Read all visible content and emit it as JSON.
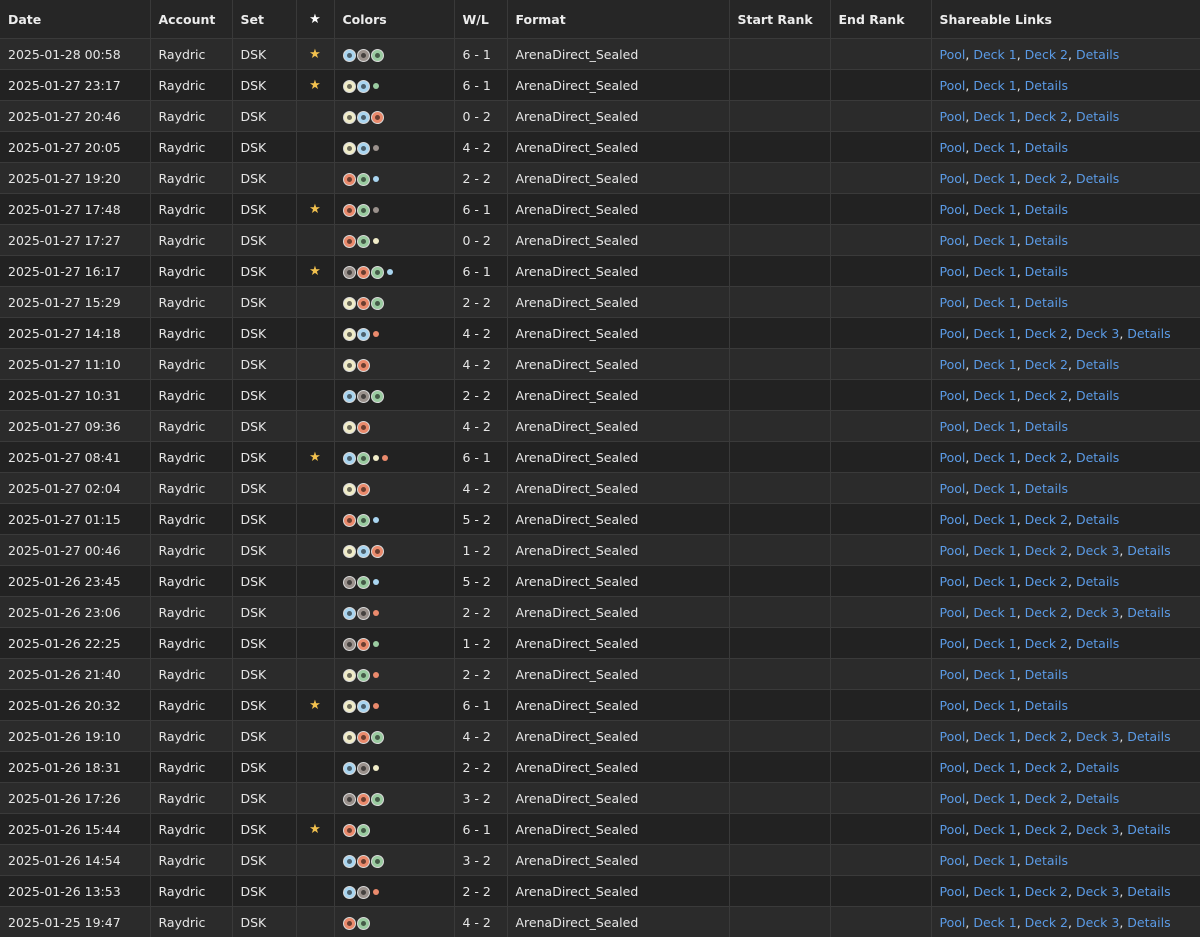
{
  "headers": {
    "date": "Date",
    "account": "Account",
    "set": "Set",
    "star": "★",
    "colors": "Colors",
    "wl": "W/L",
    "format": "Format",
    "start_rank": "Start Rank",
    "end_rank": "End Rank",
    "links": "Shareable Links"
  },
  "color_map": {
    "W": "#f0ecc8",
    "U": "#a9d5f0",
    "B": "#9a918c",
    "R": "#ea8a6c",
    "G": "#9acba0"
  },
  "rows": [
    {
      "date": "2025-01-28 00:58",
      "account": "Raydric",
      "set": "DSK",
      "starred": true,
      "symbols": [
        "U",
        "B",
        "G"
      ],
      "dots": [],
      "wl": "6 - 1",
      "format": "ArenaDirect_Sealed",
      "start_rank": "",
      "end_rank": "",
      "links": [
        "Pool",
        "Deck 1",
        "Deck 2",
        "Details"
      ]
    },
    {
      "date": "2025-01-27 23:17",
      "account": "Raydric",
      "set": "DSK",
      "starred": true,
      "symbols": [
        "W",
        "U"
      ],
      "dots": [
        "G"
      ],
      "wl": "6 - 1",
      "format": "ArenaDirect_Sealed",
      "start_rank": "",
      "end_rank": "",
      "links": [
        "Pool",
        "Deck 1",
        "Details"
      ]
    },
    {
      "date": "2025-01-27 20:46",
      "account": "Raydric",
      "set": "DSK",
      "starred": false,
      "symbols": [
        "W",
        "U",
        "R"
      ],
      "dots": [],
      "wl": "0 - 2",
      "format": "ArenaDirect_Sealed",
      "start_rank": "",
      "end_rank": "",
      "links": [
        "Pool",
        "Deck 1",
        "Deck 2",
        "Details"
      ]
    },
    {
      "date": "2025-01-27 20:05",
      "account": "Raydric",
      "set": "DSK",
      "starred": false,
      "symbols": [
        "W",
        "U"
      ],
      "dots": [
        "B"
      ],
      "wl": "4 - 2",
      "format": "ArenaDirect_Sealed",
      "start_rank": "",
      "end_rank": "",
      "links": [
        "Pool",
        "Deck 1",
        "Details"
      ]
    },
    {
      "date": "2025-01-27 19:20",
      "account": "Raydric",
      "set": "DSK",
      "starred": false,
      "symbols": [
        "R",
        "G"
      ],
      "dots": [
        "U"
      ],
      "wl": "2 - 2",
      "format": "ArenaDirect_Sealed",
      "start_rank": "",
      "end_rank": "",
      "links": [
        "Pool",
        "Deck 1",
        "Deck 2",
        "Details"
      ]
    },
    {
      "date": "2025-01-27 17:48",
      "account": "Raydric",
      "set": "DSK",
      "starred": true,
      "symbols": [
        "R",
        "G"
      ],
      "dots": [
        "B"
      ],
      "wl": "6 - 1",
      "format": "ArenaDirect_Sealed",
      "start_rank": "",
      "end_rank": "",
      "links": [
        "Pool",
        "Deck 1",
        "Details"
      ]
    },
    {
      "date": "2025-01-27 17:27",
      "account": "Raydric",
      "set": "DSK",
      "starred": false,
      "symbols": [
        "R",
        "G"
      ],
      "dots": [
        "W"
      ],
      "wl": "0 - 2",
      "format": "ArenaDirect_Sealed",
      "start_rank": "",
      "end_rank": "",
      "links": [
        "Pool",
        "Deck 1",
        "Details"
      ]
    },
    {
      "date": "2025-01-27 16:17",
      "account": "Raydric",
      "set": "DSK",
      "starred": true,
      "symbols": [
        "B",
        "R",
        "G"
      ],
      "dots": [
        "U"
      ],
      "wl": "6 - 1",
      "format": "ArenaDirect_Sealed",
      "start_rank": "",
      "end_rank": "",
      "links": [
        "Pool",
        "Deck 1",
        "Details"
      ]
    },
    {
      "date": "2025-01-27 15:29",
      "account": "Raydric",
      "set": "DSK",
      "starred": false,
      "symbols": [
        "W",
        "R",
        "G"
      ],
      "dots": [],
      "wl": "2 - 2",
      "format": "ArenaDirect_Sealed",
      "start_rank": "",
      "end_rank": "",
      "links": [
        "Pool",
        "Deck 1",
        "Details"
      ]
    },
    {
      "date": "2025-01-27 14:18",
      "account": "Raydric",
      "set": "DSK",
      "starred": false,
      "symbols": [
        "W",
        "U"
      ],
      "dots": [
        "R"
      ],
      "wl": "4 - 2",
      "format": "ArenaDirect_Sealed",
      "start_rank": "",
      "end_rank": "",
      "links": [
        "Pool",
        "Deck 1",
        "Deck 2",
        "Deck 3",
        "Details"
      ]
    },
    {
      "date": "2025-01-27 11:10",
      "account": "Raydric",
      "set": "DSK",
      "starred": false,
      "symbols": [
        "W",
        "R"
      ],
      "dots": [],
      "wl": "4 - 2",
      "format": "ArenaDirect_Sealed",
      "start_rank": "",
      "end_rank": "",
      "links": [
        "Pool",
        "Deck 1",
        "Deck 2",
        "Details"
      ]
    },
    {
      "date": "2025-01-27 10:31",
      "account": "Raydric",
      "set": "DSK",
      "starred": false,
      "symbols": [
        "U",
        "B",
        "G"
      ],
      "dots": [],
      "wl": "2 - 2",
      "format": "ArenaDirect_Sealed",
      "start_rank": "",
      "end_rank": "",
      "links": [
        "Pool",
        "Deck 1",
        "Deck 2",
        "Details"
      ]
    },
    {
      "date": "2025-01-27 09:36",
      "account": "Raydric",
      "set": "DSK",
      "starred": false,
      "symbols": [
        "W",
        "R"
      ],
      "dots": [],
      "wl": "4 - 2",
      "format": "ArenaDirect_Sealed",
      "start_rank": "",
      "end_rank": "",
      "links": [
        "Pool",
        "Deck 1",
        "Details"
      ]
    },
    {
      "date": "2025-01-27 08:41",
      "account": "Raydric",
      "set": "DSK",
      "starred": true,
      "symbols": [
        "U",
        "G"
      ],
      "dots": [
        "W",
        "R"
      ],
      "wl": "6 - 1",
      "format": "ArenaDirect_Sealed",
      "start_rank": "",
      "end_rank": "",
      "links": [
        "Pool",
        "Deck 1",
        "Deck 2",
        "Details"
      ]
    },
    {
      "date": "2025-01-27 02:04",
      "account": "Raydric",
      "set": "DSK",
      "starred": false,
      "symbols": [
        "W",
        "R"
      ],
      "dots": [],
      "wl": "4 - 2",
      "format": "ArenaDirect_Sealed",
      "start_rank": "",
      "end_rank": "",
      "links": [
        "Pool",
        "Deck 1",
        "Details"
      ]
    },
    {
      "date": "2025-01-27 01:15",
      "account": "Raydric",
      "set": "DSK",
      "starred": false,
      "symbols": [
        "R",
        "G"
      ],
      "dots": [
        "U"
      ],
      "wl": "5 - 2",
      "format": "ArenaDirect_Sealed",
      "start_rank": "",
      "end_rank": "",
      "links": [
        "Pool",
        "Deck 1",
        "Deck 2",
        "Details"
      ]
    },
    {
      "date": "2025-01-27 00:46",
      "account": "Raydric",
      "set": "DSK",
      "starred": false,
      "symbols": [
        "W",
        "U",
        "R"
      ],
      "dots": [],
      "wl": "1 - 2",
      "format": "ArenaDirect_Sealed",
      "start_rank": "",
      "end_rank": "",
      "links": [
        "Pool",
        "Deck 1",
        "Deck 2",
        "Deck 3",
        "Details"
      ]
    },
    {
      "date": "2025-01-26 23:45",
      "account": "Raydric",
      "set": "DSK",
      "starred": false,
      "symbols": [
        "B",
        "G"
      ],
      "dots": [
        "U"
      ],
      "wl": "5 - 2",
      "format": "ArenaDirect_Sealed",
      "start_rank": "",
      "end_rank": "",
      "links": [
        "Pool",
        "Deck 1",
        "Deck 2",
        "Details"
      ]
    },
    {
      "date": "2025-01-26 23:06",
      "account": "Raydric",
      "set": "DSK",
      "starred": false,
      "symbols": [
        "U",
        "B"
      ],
      "dots": [
        "R"
      ],
      "wl": "2 - 2",
      "format": "ArenaDirect_Sealed",
      "start_rank": "",
      "end_rank": "",
      "links": [
        "Pool",
        "Deck 1",
        "Deck 2",
        "Deck 3",
        "Details"
      ]
    },
    {
      "date": "2025-01-26 22:25",
      "account": "Raydric",
      "set": "DSK",
      "starred": false,
      "symbols": [
        "B",
        "R"
      ],
      "dots": [
        "G"
      ],
      "wl": "1 - 2",
      "format": "ArenaDirect_Sealed",
      "start_rank": "",
      "end_rank": "",
      "links": [
        "Pool",
        "Deck 1",
        "Deck 2",
        "Details"
      ]
    },
    {
      "date": "2025-01-26 21:40",
      "account": "Raydric",
      "set": "DSK",
      "starred": false,
      "symbols": [
        "W",
        "G"
      ],
      "dots": [
        "R"
      ],
      "wl": "2 - 2",
      "format": "ArenaDirect_Sealed",
      "start_rank": "",
      "end_rank": "",
      "links": [
        "Pool",
        "Deck 1",
        "Details"
      ]
    },
    {
      "date": "2025-01-26 20:32",
      "account": "Raydric",
      "set": "DSK",
      "starred": true,
      "symbols": [
        "W",
        "U"
      ],
      "dots": [
        "R"
      ],
      "wl": "6 - 1",
      "format": "ArenaDirect_Sealed",
      "start_rank": "",
      "end_rank": "",
      "links": [
        "Pool",
        "Deck 1",
        "Details"
      ]
    },
    {
      "date": "2025-01-26 19:10",
      "account": "Raydric",
      "set": "DSK",
      "starred": false,
      "symbols": [
        "W",
        "R",
        "G"
      ],
      "dots": [],
      "wl": "4 - 2",
      "format": "ArenaDirect_Sealed",
      "start_rank": "",
      "end_rank": "",
      "links": [
        "Pool",
        "Deck 1",
        "Deck 2",
        "Deck 3",
        "Details"
      ]
    },
    {
      "date": "2025-01-26 18:31",
      "account": "Raydric",
      "set": "DSK",
      "starred": false,
      "symbols": [
        "U",
        "B"
      ],
      "dots": [
        "W"
      ],
      "wl": "2 - 2",
      "format": "ArenaDirect_Sealed",
      "start_rank": "",
      "end_rank": "",
      "links": [
        "Pool",
        "Deck 1",
        "Deck 2",
        "Details"
      ]
    },
    {
      "date": "2025-01-26 17:26",
      "account": "Raydric",
      "set": "DSK",
      "starred": false,
      "symbols": [
        "B",
        "R",
        "G"
      ],
      "dots": [],
      "wl": "3 - 2",
      "format": "ArenaDirect_Sealed",
      "start_rank": "",
      "end_rank": "",
      "links": [
        "Pool",
        "Deck 1",
        "Deck 2",
        "Details"
      ]
    },
    {
      "date": "2025-01-26 15:44",
      "account": "Raydric",
      "set": "DSK",
      "starred": true,
      "symbols": [
        "R",
        "G"
      ],
      "dots": [],
      "wl": "6 - 1",
      "format": "ArenaDirect_Sealed",
      "start_rank": "",
      "end_rank": "",
      "links": [
        "Pool",
        "Deck 1",
        "Deck 2",
        "Deck 3",
        "Details"
      ]
    },
    {
      "date": "2025-01-26 14:54",
      "account": "Raydric",
      "set": "DSK",
      "starred": false,
      "symbols": [
        "U",
        "R",
        "G"
      ],
      "dots": [],
      "wl": "3 - 2",
      "format": "ArenaDirect_Sealed",
      "start_rank": "",
      "end_rank": "",
      "links": [
        "Pool",
        "Deck 1",
        "Details"
      ]
    },
    {
      "date": "2025-01-26 13:53",
      "account": "Raydric",
      "set": "DSK",
      "starred": false,
      "symbols": [
        "U",
        "B"
      ],
      "dots": [
        "R"
      ],
      "wl": "2 - 2",
      "format": "ArenaDirect_Sealed",
      "start_rank": "",
      "end_rank": "",
      "links": [
        "Pool",
        "Deck 1",
        "Deck 2",
        "Deck 3",
        "Details"
      ]
    },
    {
      "date": "2025-01-25 19:47",
      "account": "Raydric",
      "set": "DSK",
      "starred": false,
      "symbols": [
        "R",
        "G"
      ],
      "dots": [],
      "wl": "4 - 2",
      "format": "ArenaDirect_Sealed",
      "start_rank": "",
      "end_rank": "",
      "links": [
        "Pool",
        "Deck 1",
        "Deck 2",
        "Deck 3",
        "Details"
      ]
    }
  ]
}
